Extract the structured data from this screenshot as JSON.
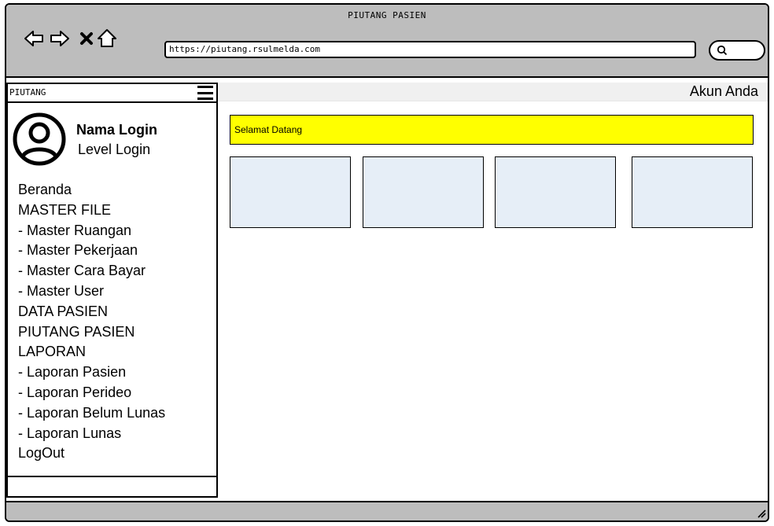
{
  "window": {
    "title": "PIUTANG PASIEN",
    "url": "https://piutang.rsulmelda.com"
  },
  "icons": {
    "back": "arrow-left-icon",
    "forward": "arrow-right-icon",
    "stop": "close-icon",
    "home": "home-icon",
    "search": "search-icon",
    "menu": "hamburger-icon",
    "user": "user-avatar-icon"
  },
  "sidebar": {
    "header": "PIUTANG",
    "user": {
      "name": "Nama Login",
      "level": "Level Login"
    },
    "menu": [
      "Beranda",
      "MASTER FILE",
      "- Master Ruangan",
      "- Master Pekerjaan",
      "- Master Cara Bayar",
      "- Master User",
      "DATA PASIEN",
      "PIUTANG PASIEN",
      "LAPORAN",
      "- Laporan Pasien",
      "- Laporan Perideo",
      "- Laporan Belum Lunas",
      "- Laporan Lunas",
      "LogOut"
    ]
  },
  "header": {
    "account": "Akun Anda"
  },
  "main": {
    "welcome": "Selamat Datang"
  },
  "colors": {
    "chrome": "#bdbdbd",
    "welcome_bg": "#ffff00",
    "card_bg": "#e6eef7",
    "topbar_bg": "#f0f0f0"
  }
}
